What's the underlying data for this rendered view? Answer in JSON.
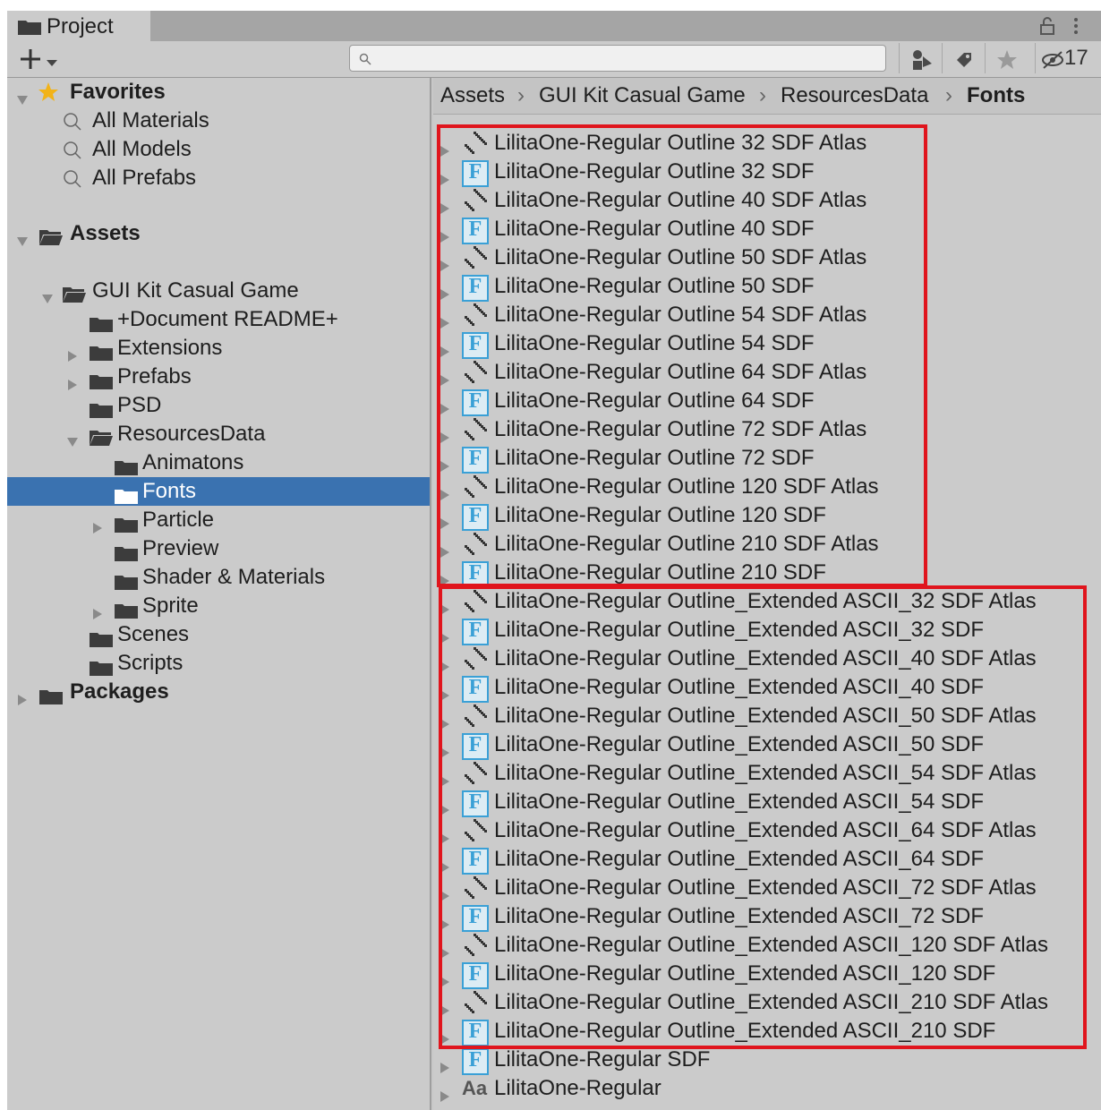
{
  "window": {
    "tab_label": "Project",
    "hidden_count": "17",
    "search": {
      "placeholder": "",
      "value": ""
    }
  },
  "tree": {
    "favorites": {
      "label": "Favorites",
      "items": [
        "All Materials",
        "All Models",
        "All Prefabs"
      ]
    },
    "assets_label": "Assets",
    "gui_kit_label": "GUI Kit Casual Game",
    "folders": [
      "+Document README+",
      "Extensions",
      "Prefabs",
      "PSD",
      "ResourcesData",
      "Animatons",
      "Fonts",
      "Particle",
      "Preview",
      "Shader & Materials",
      "Sprite",
      "Scenes",
      "Scripts"
    ],
    "packages_label": "Packages",
    "selected": "Fonts"
  },
  "breadcrumb": [
    "Assets",
    "GUI Kit Casual Game",
    "ResourcesData",
    "Fonts"
  ],
  "files": [
    {
      "name": "LilitaOne-Regular Outline 32 SDF Atlas",
      "icon": "texture-icon"
    },
    {
      "name": "LilitaOne-Regular Outline 32 SDF",
      "icon": "font-asset-icon"
    },
    {
      "name": "LilitaOne-Regular Outline 40 SDF Atlas",
      "icon": "texture-icon"
    },
    {
      "name": "LilitaOne-Regular Outline 40 SDF",
      "icon": "font-asset-icon"
    },
    {
      "name": "LilitaOne-Regular Outline 50 SDF Atlas",
      "icon": "texture-icon"
    },
    {
      "name": "LilitaOne-Regular Outline 50 SDF",
      "icon": "font-asset-icon"
    },
    {
      "name": "LilitaOne-Regular Outline 54 SDF Atlas",
      "icon": "texture-icon"
    },
    {
      "name": "LilitaOne-Regular Outline 54 SDF",
      "icon": "font-asset-icon"
    },
    {
      "name": "LilitaOne-Regular Outline 64 SDF Atlas",
      "icon": "texture-icon"
    },
    {
      "name": "LilitaOne-Regular Outline 64 SDF",
      "icon": "font-asset-icon"
    },
    {
      "name": "LilitaOne-Regular Outline 72 SDF Atlas",
      "icon": "texture-icon"
    },
    {
      "name": "LilitaOne-Regular Outline 72 SDF",
      "icon": "font-asset-icon"
    },
    {
      "name": "LilitaOne-Regular Outline 120 SDF Atlas",
      "icon": "texture-icon"
    },
    {
      "name": "LilitaOne-Regular Outline 120 SDF",
      "icon": "font-asset-icon"
    },
    {
      "name": "LilitaOne-Regular Outline 210 SDF Atlas",
      "icon": "texture-icon"
    },
    {
      "name": "LilitaOne-Regular Outline 210 SDF",
      "icon": "font-asset-icon"
    },
    {
      "name": "LilitaOne-Regular Outline_Extended ASCII_32 SDF Atlas",
      "icon": "texture-icon"
    },
    {
      "name": "LilitaOne-Regular Outline_Extended ASCII_32 SDF",
      "icon": "font-asset-icon"
    },
    {
      "name": "LilitaOne-Regular Outline_Extended ASCII_40 SDF Atlas",
      "icon": "texture-icon"
    },
    {
      "name": "LilitaOne-Regular Outline_Extended ASCII_40 SDF",
      "icon": "font-asset-icon"
    },
    {
      "name": "LilitaOne-Regular Outline_Extended ASCII_50 SDF Atlas",
      "icon": "texture-icon"
    },
    {
      "name": "LilitaOne-Regular Outline_Extended ASCII_50 SDF",
      "icon": "font-asset-icon"
    },
    {
      "name": "LilitaOne-Regular Outline_Extended ASCII_54 SDF Atlas",
      "icon": "texture-icon"
    },
    {
      "name": "LilitaOne-Regular Outline_Extended ASCII_54 SDF",
      "icon": "font-asset-icon"
    },
    {
      "name": "LilitaOne-Regular Outline_Extended ASCII_64 SDF Atlas",
      "icon": "texture-icon"
    },
    {
      "name": "LilitaOne-Regular Outline_Extended ASCII_64 SDF",
      "icon": "font-asset-icon"
    },
    {
      "name": "LilitaOne-Regular Outline_Extended ASCII_72 SDF Atlas",
      "icon": "texture-icon"
    },
    {
      "name": "LilitaOne-Regular Outline_Extended ASCII_72 SDF",
      "icon": "font-asset-icon"
    },
    {
      "name": "LilitaOne-Regular Outline_Extended ASCII_120 SDF Atlas",
      "icon": "texture-icon"
    },
    {
      "name": "LilitaOne-Regular Outline_Extended ASCII_120 SDF",
      "icon": "font-asset-icon"
    },
    {
      "name": "LilitaOne-Regular Outline_Extended ASCII_210 SDF Atlas",
      "icon": "texture-icon"
    },
    {
      "name": "LilitaOne-Regular Outline_Extended ASCII_210 SDF",
      "icon": "font-asset-icon"
    },
    {
      "name": "LilitaOne-Regular SDF",
      "icon": "font-asset-icon"
    },
    {
      "name": "LilitaOne-Regular",
      "icon": "font-file-icon",
      "glyph": "Aa"
    }
  ],
  "colors": {
    "selection": "#3a72b0",
    "highlight_box": "#e0151d",
    "font_icon": "#3aa0d6",
    "favorites_star": "#f2b318"
  }
}
